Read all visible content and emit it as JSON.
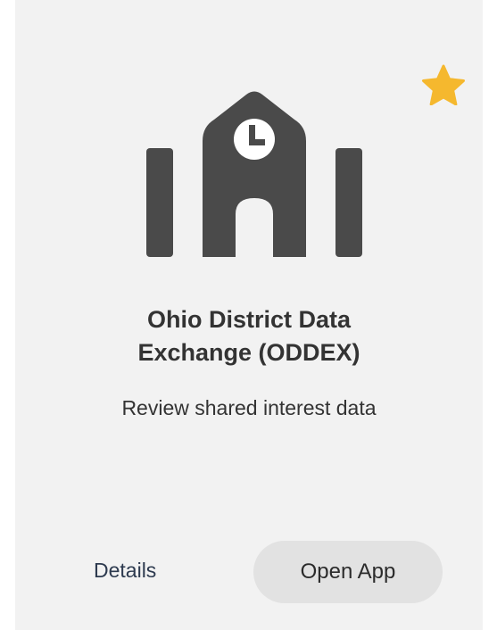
{
  "card": {
    "title_line_1": "Ohio District Data",
    "title_line_2": "Exchange (ODDEX)",
    "description": "Review shared interest data",
    "details_label": "Details",
    "open_label": "Open App",
    "favorite": true,
    "icon": "school-clock-icon",
    "favorite_icon": "star-icon"
  },
  "colors": {
    "card_background": "#f2f2f2",
    "icon": "#4a4a4a",
    "star": "#f5b82e",
    "text": "#333333",
    "open_button_background": "#e2e2e2"
  }
}
